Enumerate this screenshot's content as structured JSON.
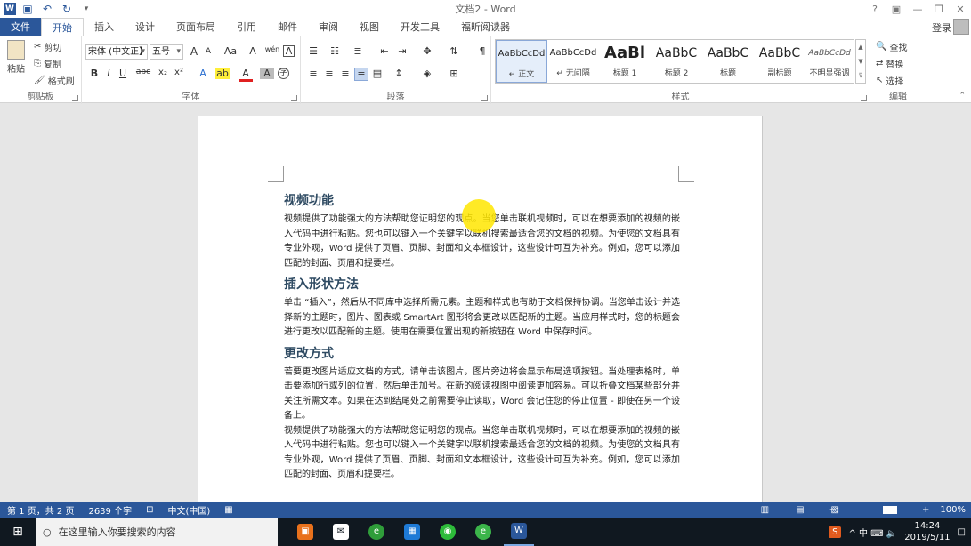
{
  "window": {
    "title": "文档2 - Word",
    "controls": [
      "?",
      "▣",
      "—",
      "❐",
      "✕"
    ]
  },
  "tabs": [
    "文件",
    "开始",
    "插入",
    "设计",
    "页面布局",
    "引用",
    "邮件",
    "审阅",
    "视图",
    "开发工具",
    "福昕阅读器"
  ],
  "account": {
    "login": "登录"
  },
  "ribbon": {
    "clipboard": {
      "label": "剪贴板",
      "paste": "粘贴",
      "cut": "剪切",
      "copy": "复制",
      "format_painter": "格式刷"
    },
    "font": {
      "label": "字体",
      "font_name": "宋体 (中文正】",
      "font_size": "五号",
      "bold": "B",
      "italic": "I",
      "underline": "U",
      "strike": "abc",
      "subscript": "x₂",
      "superscript": "x²",
      "grow": "A",
      "shrink": "A",
      "case": "Aa",
      "clear": "A",
      "phonetic": "wén",
      "border": "A"
    },
    "paragraph": {
      "label": "段落"
    },
    "styles": {
      "label": "样式",
      "items": [
        {
          "preview": "AaBbCcDd",
          "name": "↵ 正文"
        },
        {
          "preview": "AaBbCcDd",
          "name": "↵ 无间隔"
        },
        {
          "preview": "AaBl",
          "name": "标题 1"
        },
        {
          "preview": "AaBbC",
          "name": "标题 2"
        },
        {
          "preview": "AaBbC",
          "name": "标题"
        },
        {
          "preview": "AaBbC",
          "name": "副标题"
        },
        {
          "preview": "AaBbCcDd",
          "name": "不明显强调"
        }
      ]
    },
    "editing": {
      "label": "编辑",
      "find": "查找",
      "replace": "替换",
      "select": "选择"
    }
  },
  "document": {
    "sections": [
      {
        "heading": "视频功能",
        "paragraphs": [
          "视频提供了功能强大的方法帮助您证明您的观点。当您单击联机视频时，可以在想要添加的视频的嵌入代码中进行粘贴。您也可以键入一个关键字以联机搜索最适合您的文档的视频。为使您的文档具有专业外观，Word 提供了页眉、页脚、封面和文本框设计，这些设计可互为补充。例如，您可以添加匹配的封面、页眉和提要栏。"
        ]
      },
      {
        "heading": "插入形状方法",
        "paragraphs": [
          "单击 “插入”，然后从不同库中选择所需元素。主题和样式也有助于文档保持协调。当您单击设计并选择新的主题时，图片、图表或 SmartArt 图形将会更改以匹配新的主题。当应用样式时，您的标题会进行更改以匹配新的主题。使用在需要位置出现的新按钮在 Word 中保存时间。"
        ]
      },
      {
        "heading": "更改方式",
        "paragraphs": [
          "若要更改图片适应文档的方式，请单击该图片，图片旁边将会显示布局选项按钮。当处理表格时，单击要添加行或列的位置，然后单击加号。在新的阅读视图中阅读更加容易。可以折叠文档某些部分并关注所需文本。如果在达到结尾处之前需要停止读取，Word 会记住您的停止位置 - 即使在另一个设备上。",
          "视频提供了功能强大的方法帮助您证明您的观点。当您单击联机视频时，可以在想要添加的视频的嵌入代码中进行粘贴。您也可以键入一个关键字以联机搜索最适合您的文档的视频。为使您的文档具有专业外观，Word 提供了页眉、页脚、封面和文本框设计，这些设计可互为补充。例如，您可以添加匹配的封面、页眉和提要栏。"
        ]
      }
    ]
  },
  "status": {
    "page": "第 1 页，共 2 页",
    "words": "2639 个字",
    "language": "中文(中国)",
    "zoom": "100%",
    "zoom_minus": "−",
    "zoom_plus": "+"
  },
  "taskbar": {
    "search_placeholder": "在这里输入你要搜索的内容",
    "time": "14:24",
    "date": "2019/5/11",
    "tray_label": "^ 中 ⌨ 🔈",
    "ime_label": "S",
    "notify_icon": "□"
  }
}
